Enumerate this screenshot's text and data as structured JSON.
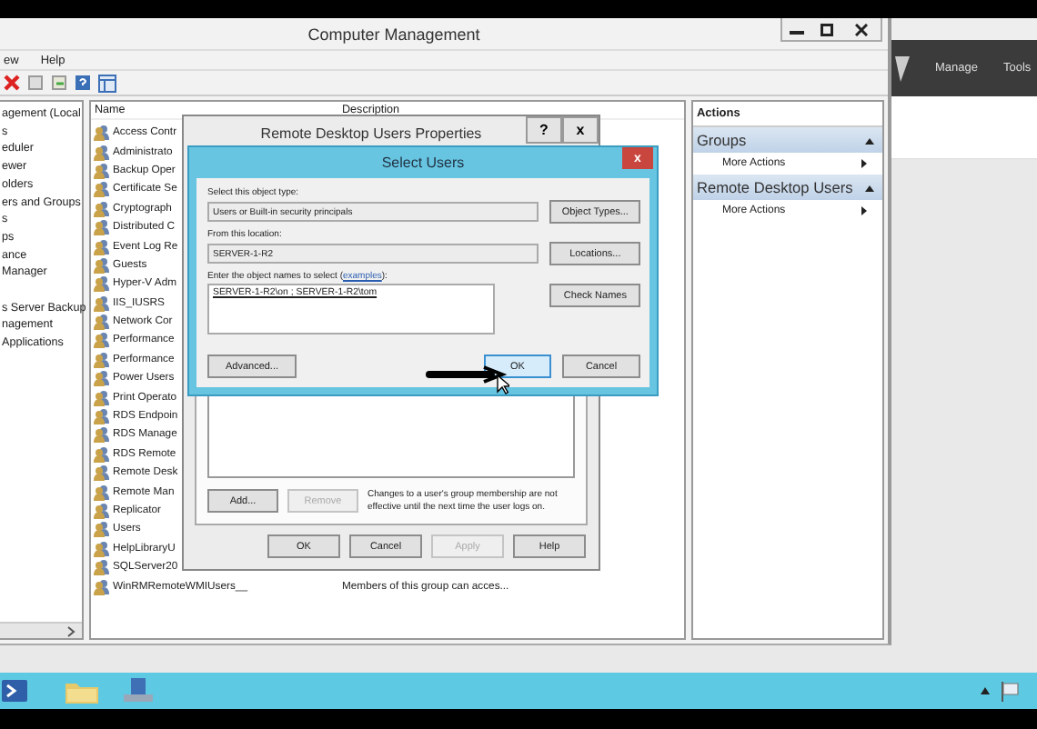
{
  "main_window": {
    "title": "Computer Management",
    "menu": [
      "ew",
      "Help"
    ],
    "tree": [
      "agement (Local",
      "s",
      "eduler",
      "ewer",
      "olders",
      "ers and Groups",
      "s",
      "ps",
      "ance",
      "Manager",
      "s Server Backup",
      "nagement",
      "Applications"
    ],
    "columns": [
      "Name",
      "Description"
    ],
    "rows": [
      {
        "name": "Access Contr"
      },
      {
        "name": "Administrato"
      },
      {
        "name": "Backup Oper"
      },
      {
        "name": "Certificate Se"
      },
      {
        "name": "Cryptograph"
      },
      {
        "name": "Distributed C"
      },
      {
        "name": "Event Log Re"
      },
      {
        "name": "Guests"
      },
      {
        "name": "Hyper-V Adm"
      },
      {
        "name": "IIS_IUSRS"
      },
      {
        "name": "Network Cor"
      },
      {
        "name": "Performance"
      },
      {
        "name": "Performance"
      },
      {
        "name": "Power Users"
      },
      {
        "name": "Print Operato"
      },
      {
        "name": "RDS Endpoin"
      },
      {
        "name": "RDS Manage"
      },
      {
        "name": "RDS Remote"
      },
      {
        "name": "Remote Desk"
      },
      {
        "name": "Remote Man"
      },
      {
        "name": "Replicator"
      },
      {
        "name": "Users"
      },
      {
        "name": "HelpLibraryU"
      },
      {
        "name": "SQLServer20"
      },
      {
        "name": "WinRMRemoteWMIUsers__",
        "description": "Members of this group can acces..."
      }
    ],
    "actions": {
      "title": "Actions",
      "sections": [
        {
          "title": "Groups",
          "items": [
            "More Actions"
          ]
        },
        {
          "title": "Remote Desktop Users",
          "items": [
            "More Actions"
          ]
        }
      ]
    }
  },
  "server_manager": {
    "menu": [
      "Manage",
      "Tools"
    ]
  },
  "properties_dialog": {
    "title": "Remote Desktop Users Properties",
    "help": "?",
    "close": "x",
    "add": {
      "label": "Add...",
      "disabled": false
    },
    "remove": {
      "label": "Remove",
      "disabled": true
    },
    "note": "Changes to a user's group membership are not effective until the next time the user logs on.",
    "buttons": [
      {
        "label": "OK",
        "disabled": false
      },
      {
        "label": "Cancel",
        "disabled": false
      },
      {
        "label": "Apply",
        "disabled": true
      },
      {
        "label": "Help",
        "disabled": false
      }
    ]
  },
  "select_users": {
    "title": "Select Users",
    "close": "x",
    "object_type_label": "Select this object type:",
    "object_type": "Users or Built-in security principals",
    "object_types_button": "Object Types...",
    "location_label": "From this location:",
    "location": "SERVER-1-R2",
    "locations_button": "Locations...",
    "names_label_before": "Enter the object names to select (",
    "names_label_link": "examples",
    "names_label_after": "):",
    "names": "SERVER-1-R2\\on ; SERVER-1-R2\\tom",
    "check_names_button": "Check Names",
    "advanced_button": "Advanced...",
    "ok_button": "OK",
    "cancel_button": "Cancel"
  }
}
